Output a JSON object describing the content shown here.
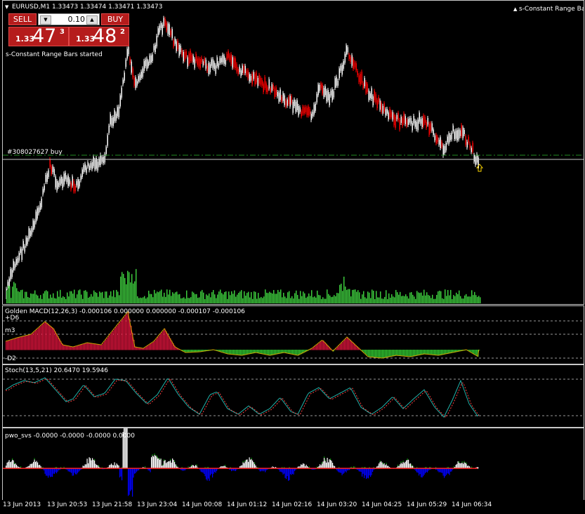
{
  "main_chart": {
    "title": "EURUSD,M1  1.33473 1.33474 1.33471 1.33473",
    "indicator_name": "s-Constant Range Bars",
    "status_message": "s-Constant Range Bars started",
    "order_label": "#308027627 buy"
  },
  "one_click_trading": {
    "sell_label": "SELL",
    "buy_label": "BUY",
    "lot_value": "0.10",
    "sell_price": {
      "prefix": "1.33",
      "big": "47",
      "sup": "3"
    },
    "buy_price": {
      "prefix": "1.33",
      "big": "48",
      "sup": "2"
    }
  },
  "macd": {
    "title": "Golden MACD(12,26,3) -0.000106 0.000000 0.000000 -0.000107 -0.000106",
    "level_top": "+D6",
    "level_mid": "m3",
    "level_bot": "-D2"
  },
  "stoch": {
    "title": "Stoch(13,5,21) 20.6470 19.5946"
  },
  "pwo": {
    "title": "pwo_svs -0.0000 -0.0000 -0.0000 0.0000"
  },
  "time_axis": [
    "13 Jun 2013",
    "13 Jun 20:53",
    "13 Jun 21:58",
    "13 Jun 23:04",
    "14 Jun 00:08",
    "14 Jun 01:12",
    "14 Jun 02:16",
    "14 Jun 03:20",
    "14 Jun 04:25",
    "14 Jun 05:29",
    "14 Jun 06:34"
  ],
  "colors": {
    "background": "#000000",
    "bull_candle": "#ffffff",
    "bear_candle": "#ff0000",
    "volume": "#3cc83c",
    "order_line": "#228b22",
    "macd_pos": "#dc143c",
    "macd_neg": "#32cd32",
    "stoch_main": "#20b2aa",
    "stoch_signal": "#ff4040",
    "pwo_pos": "#ffffff",
    "pwo_neg": "#0000ff"
  }
}
